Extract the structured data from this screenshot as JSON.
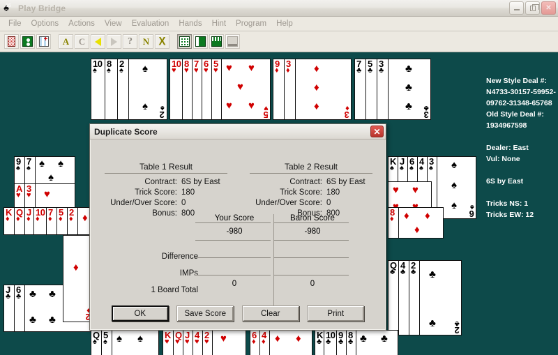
{
  "window": {
    "title": "Play Bridge",
    "icon": "spade-badge-icon",
    "minimize_label": "_",
    "restore_label": "❐",
    "close_label": "✕"
  },
  "menu": {
    "items": [
      {
        "label": "File"
      },
      {
        "label": "Options"
      },
      {
        "label": "Actions"
      },
      {
        "label": "View"
      },
      {
        "label": "Evaluation"
      },
      {
        "label": "Hands"
      },
      {
        "label": "Hint"
      },
      {
        "label": "Program"
      },
      {
        "label": "Help"
      }
    ]
  },
  "toolbar": {
    "buttons": [
      {
        "name": "card-back-icon",
        "label": ""
      },
      {
        "name": "green-table-icon",
        "label": ""
      },
      {
        "name": "card-fan-icon",
        "label": ""
      },
      {
        "name": "auction-letter-a-icon",
        "label": "A"
      },
      {
        "name": "contract-letter-c-icon",
        "label": "C"
      },
      {
        "name": "previous-arrow-icon",
        "label": ""
      },
      {
        "name": "next-arrow-icon",
        "label": ""
      },
      {
        "name": "help-question-icon",
        "label": "?"
      },
      {
        "name": "north-letter-n-icon",
        "label": "N"
      },
      {
        "name": "claim-x-icon",
        "label": "X"
      },
      {
        "name": "table-grid-icon",
        "label": ""
      },
      {
        "name": "table-split-icon",
        "label": ""
      },
      {
        "name": "table-rows-icon",
        "label": ""
      },
      {
        "name": "table-blank-icon",
        "label": ""
      }
    ]
  },
  "sidebar": {
    "new_style_deal_label": "New Style Deal #:",
    "new_style_deal_line1": "N4733-30157-59952-",
    "new_style_deal_line2": "09762-31348-65768",
    "old_style_deal_label": "Old Style Deal #:",
    "old_style_deal_value": "1934967598",
    "dealer": "Dealer: East",
    "vulnerability": "Vul: None",
    "contract": "6S by East",
    "tricks_ns": "Tricks NS: 1",
    "tricks_ew": "Tricks EW: 12"
  },
  "table": {
    "felt_color": "#0d4a4a",
    "hands": {
      "north": [
        {
          "suit": "spades",
          "symbol": "♠",
          "color": "#000000",
          "ranks": [
            "10",
            "8",
            "2"
          ]
        },
        {
          "suit": "hearts",
          "symbol": "♥",
          "color": "#d00000",
          "ranks": [
            "10",
            "8",
            "7",
            "6",
            "5"
          ]
        },
        {
          "suit": "diamonds",
          "symbol": "♦",
          "color": "#d00000",
          "ranks": [
            "9",
            "3"
          ]
        },
        {
          "suit": "clubs",
          "symbol": "♣",
          "color": "#000000",
          "ranks": [
            "7",
            "5",
            "3"
          ]
        }
      ],
      "west": [
        {
          "suit": "spades",
          "symbol": "♠",
          "color": "#000000",
          "ranks": [
            "9",
            "7"
          ]
        },
        {
          "suit": "hearts",
          "symbol": "♥",
          "color": "#d00000",
          "ranks": [
            "A",
            "3"
          ]
        },
        {
          "suit": "diamonds",
          "symbol": "♦",
          "color": "#d00000",
          "ranks": [
            "K",
            "Q",
            "J",
            "10",
            "7",
            "5",
            "2"
          ]
        },
        {
          "suit": "clubs",
          "symbol": "♣",
          "color": "#000000",
          "ranks": [
            "J",
            "6"
          ]
        }
      ],
      "east": [
        {
          "suit": "spades",
          "symbol": "♠",
          "color": "#000000",
          "ranks": [
            "K",
            "J",
            "6",
            "4",
            "3"
          ]
        },
        {
          "suit": "hearts",
          "symbol": "♥",
          "color": "#d00000",
          "ranks": [
            "",
            ""
          ]
        },
        {
          "suit": "diamonds",
          "symbol": "♦",
          "color": "#d00000",
          "ranks": [
            "8"
          ]
        },
        {
          "suit": "clubs",
          "symbol": "♣",
          "color": "#000000",
          "ranks": [
            "Q",
            "4",
            "2"
          ]
        }
      ],
      "south": [
        {
          "suit": "spades",
          "symbol": "♠",
          "color": "#000000",
          "ranks": [
            "Q",
            "5"
          ]
        },
        {
          "suit": "hearts",
          "symbol": "♥",
          "color": "#d00000",
          "ranks": [
            "K",
            "Q",
            "J",
            "4",
            "2"
          ]
        },
        {
          "suit": "diamonds",
          "symbol": "♦",
          "color": "#d00000",
          "ranks": [
            "6",
            "4"
          ]
        },
        {
          "suit": "clubs",
          "symbol": "♣",
          "color": "#000000",
          "ranks": [
            "K",
            "10",
            "9",
            "8"
          ]
        }
      ]
    }
  },
  "dialog": {
    "title": "Duplicate Score",
    "close_label": "✕",
    "table1": {
      "heading": "Table 1 Result",
      "rows": [
        {
          "label": "Contract:",
          "value": "6S by East"
        },
        {
          "label": "Trick Score:",
          "value": "180"
        },
        {
          "label": "Under/Over Score:",
          "value": "0"
        },
        {
          "label": "Bonus:",
          "value": "800"
        }
      ]
    },
    "table2": {
      "heading": "Table 2 Result",
      "rows": [
        {
          "label": "Contract:",
          "value": "6S by East"
        },
        {
          "label": "Trick Score:",
          "value": "180"
        },
        {
          "label": "Under/Over Score:",
          "value": "0"
        },
        {
          "label": "Bonus:",
          "value": "800"
        }
      ]
    },
    "score": {
      "col1_header": "Your Score",
      "col2_header": "Baron Score",
      "rows": [
        {
          "label": "",
          "your": "-980",
          "baron": "-980"
        },
        {
          "label": "Difference",
          "your": "",
          "baron": ""
        },
        {
          "label": "IMPs",
          "your": "",
          "baron": ""
        },
        {
          "label": "1 Board Total",
          "your": "0",
          "baron": "0"
        }
      ]
    },
    "buttons": [
      {
        "label": "OK",
        "name": "ok-button",
        "default": true
      },
      {
        "label": "Save Score",
        "name": "save-score-button",
        "default": false
      },
      {
        "label": "Clear",
        "name": "clear-button",
        "default": false
      },
      {
        "label": "Print",
        "name": "print-button",
        "default": false
      }
    ]
  }
}
